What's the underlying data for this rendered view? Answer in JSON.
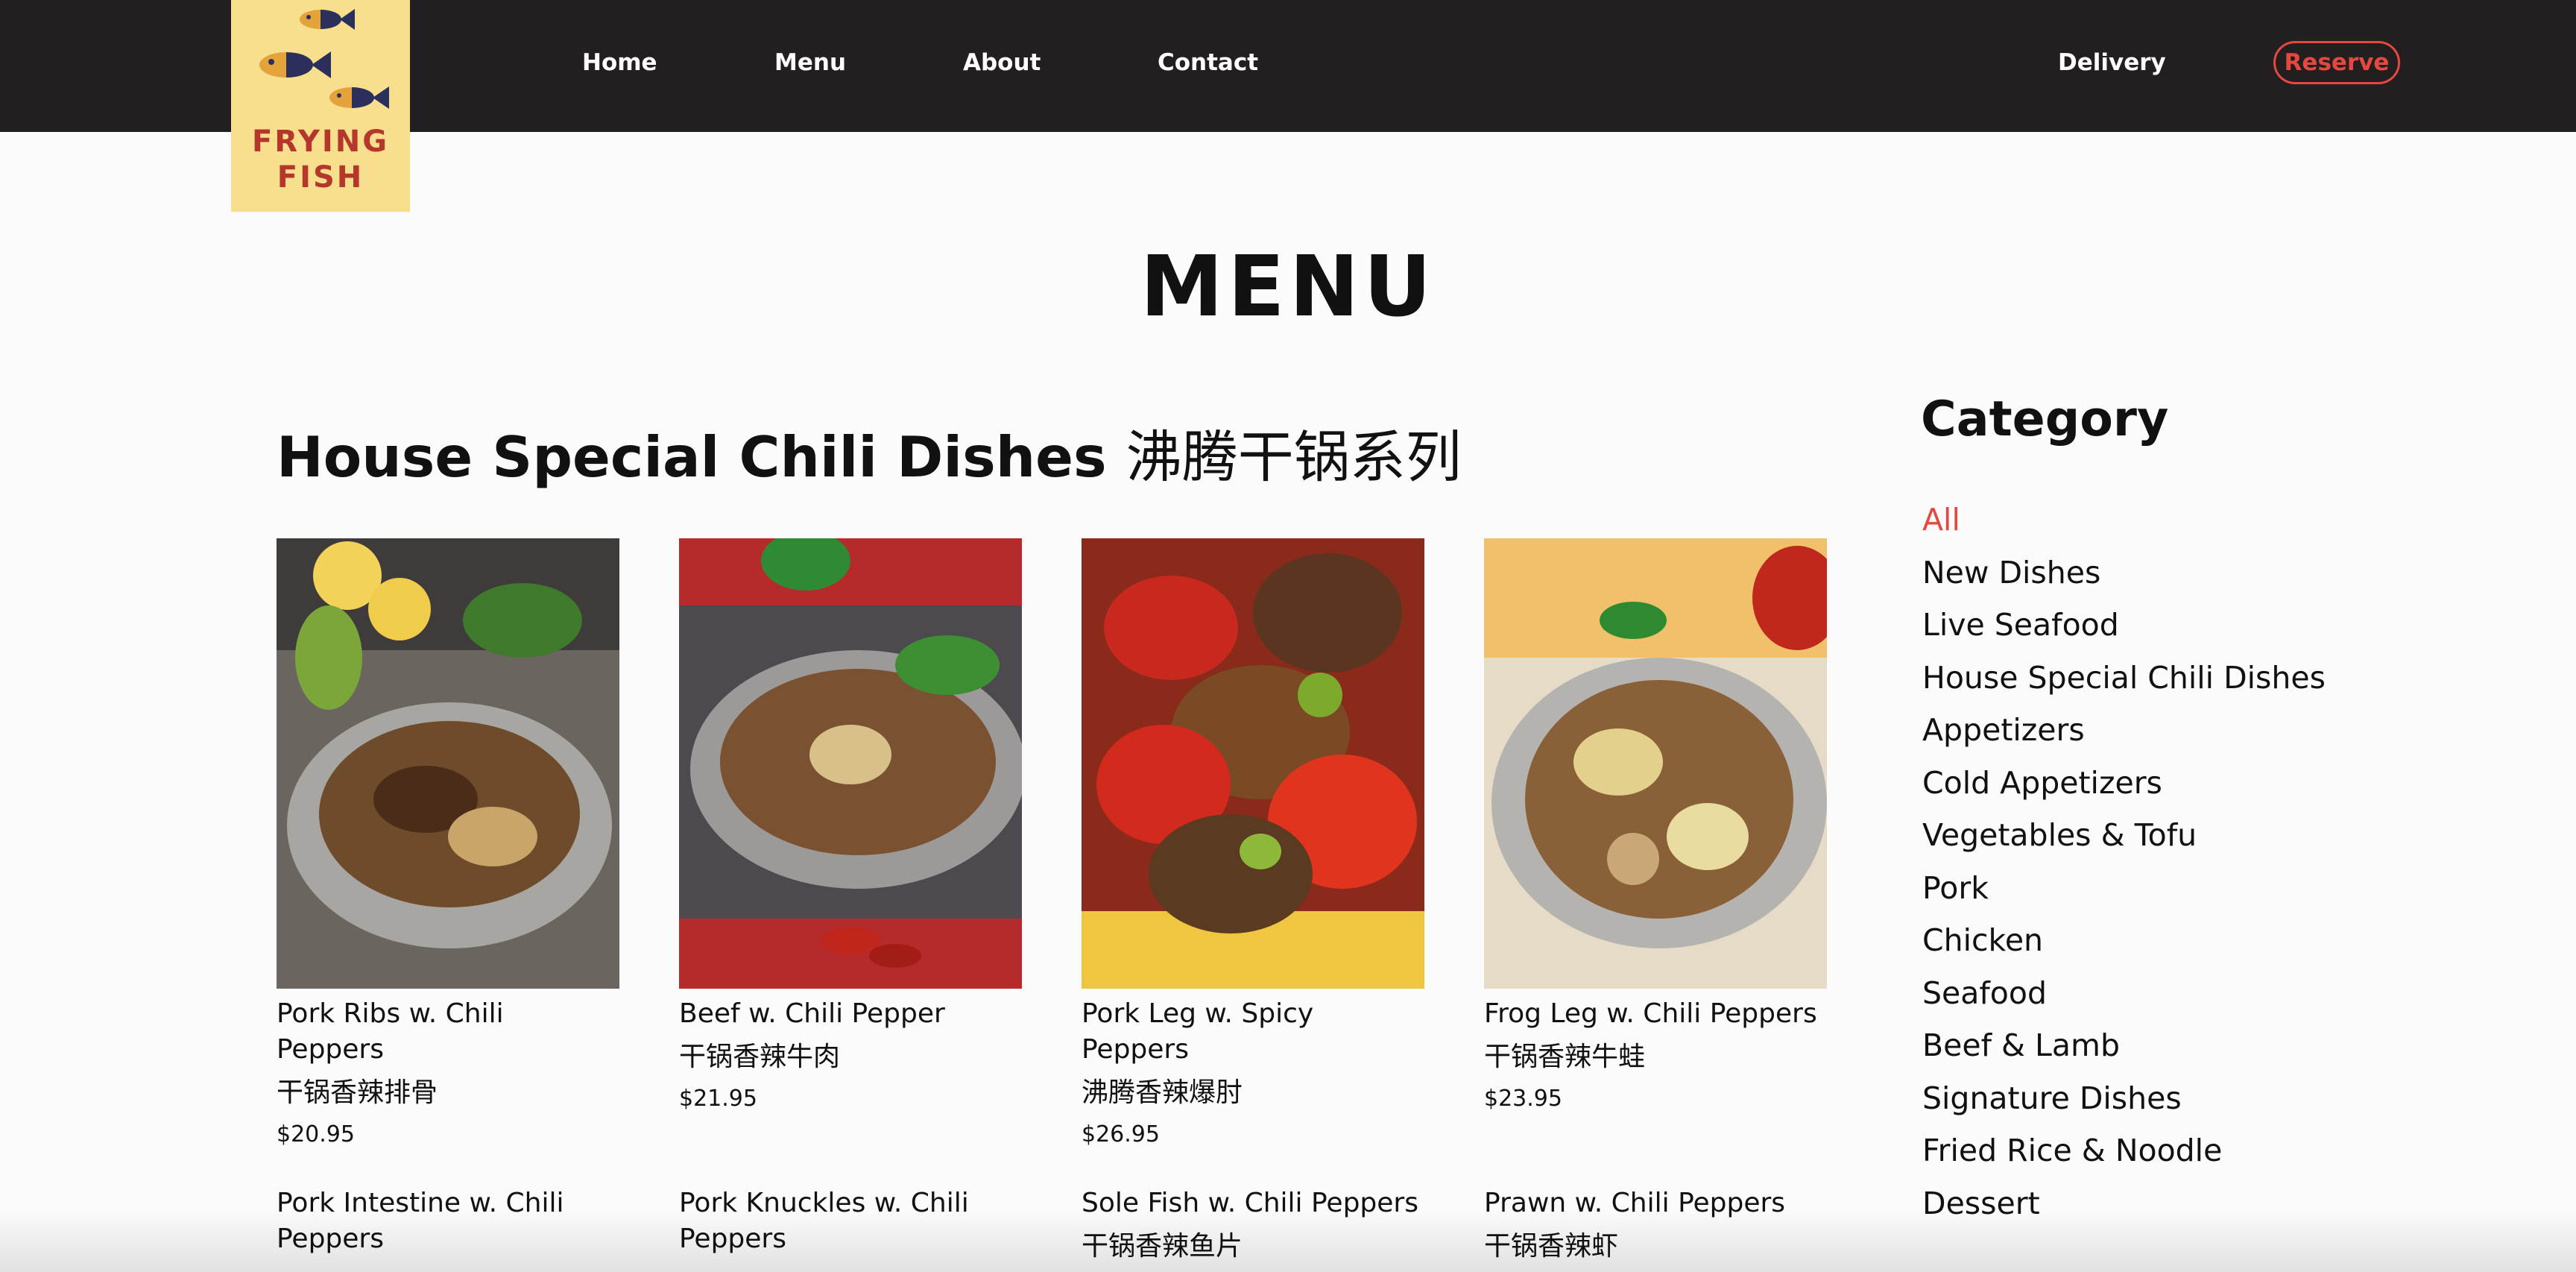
{
  "header": {
    "logo_line1": "FRYING",
    "logo_line2": "FISH",
    "nav": [
      "Home",
      "Menu",
      "About",
      "Contact"
    ],
    "delivery": "Delivery",
    "reserve": "Reserve"
  },
  "page_title": "MENU",
  "section": {
    "title_en": "House Special Chili Dishes",
    "title_zh": "沸腾干锅系列"
  },
  "dishes": [
    {
      "name": "Pork Ribs w. Chili Peppers",
      "zh": "干锅香辣排骨",
      "price": "$20.95"
    },
    {
      "name": "Beef w. Chili Pepper",
      "zh": "干锅香辣牛肉",
      "price": "$21.95"
    },
    {
      "name": "Pork Leg w. Spicy Peppers",
      "zh": "沸腾香辣爆肘",
      "price": "$26.95"
    },
    {
      "name": "Frog Leg w. Chili Peppers",
      "zh": "干锅香辣牛蛙",
      "price": "$23.95"
    },
    {
      "name": "Pork Intestine w. Chili Peppers"
    },
    {
      "name": "Pork Knuckles w. Chili Peppers"
    },
    {
      "name": "Sole Fish w. Chili Peppers",
      "zh": "干锅香辣鱼片"
    },
    {
      "name": "Prawn w. Chili Peppers",
      "zh": "干锅香辣虾"
    }
  ],
  "category": {
    "title": "Category",
    "items": [
      "All",
      "New Dishes",
      "Live Seafood",
      "House Special Chili Dishes",
      "Appetizers",
      "Cold Appetizers",
      "Vegetables & Tofu",
      "Pork",
      "Chicken",
      "Seafood",
      "Beef & Lamb",
      "Signature Dishes",
      "Fried Rice & Noodle",
      "Dessert"
    ],
    "active": "All"
  },
  "colors": {
    "header_bg": "#231f20",
    "logo_bg": "#f8df8e",
    "accent": "#e4483f"
  }
}
